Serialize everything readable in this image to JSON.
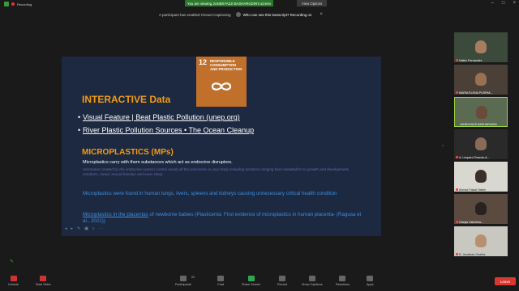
{
  "topbar": {
    "recording_label": "Recording",
    "banner": "You are viewing JUNIDIYAZJI BASHARUDIN's screen",
    "view_options": "View Options"
  },
  "notice": {
    "message": "A participant has enabled Closed Captioning",
    "ask": "Who can see this transcript? Recording on"
  },
  "slide": {
    "sdg": {
      "number": "12",
      "title": "RESPONSIBLE CONSUMPTION AND PRODUCTION"
    },
    "heading_interactive": "INTERACTIVE Data",
    "links": [
      "Visual Feature | Beat Plastic Pollution (unep.org)",
      "River Plastic Pollution Sources • The Ocean Cleanup"
    ],
    "bullet": "•",
    "heading_micro": "MICROPLASTICS (MPs)",
    "p_white": "Microplastics carry with them substances which act as endocrine disruptors.",
    "p_italic": "Hormones created by the endocrine system control nearly all the processes in your body including functions ranging from metabolism to growth and development, emotions, mood, sexual function and even sleep.",
    "p_blue1": "Microplastics were found in human lungs, livers, spleens and kidneys causing unnecessary critical health condition",
    "p_blue2_link": "Microplastics in the placentas",
    "p_blue2_rest": " of newborne babies (Plasticenta: First evidence of microplastics in human placenta- (Ragusa et al., 2021))",
    "controls": [
      "◂",
      "▸",
      "✎",
      "▣",
      "⌕",
      "⋯"
    ]
  },
  "gallery": [
    {
      "name": "Hakim Fernandez"
    },
    {
      "name": "MARIA ELENA PUSPAK..."
    },
    {
      "name": "JUNIDIYAZJI BASHARUDIN"
    },
    {
      "name": "A. Leopard Ovacdu-A..."
    },
    {
      "name": "Ahmad Faisal Hakim"
    },
    {
      "name": "Gladys Valentina..."
    },
    {
      "name": "R. Jonathan Ovallos"
    }
  ],
  "toolbar": {
    "unmute": "Unmute",
    "start_video": "Start Video",
    "participants": "Participants",
    "participants_count": "22",
    "chat": "Chat",
    "share_screen": "Share Screen",
    "record": "Record",
    "show_captions": "Show Captions",
    "reactions": "Reactions",
    "apps": "Apps",
    "leave": "Leave"
  }
}
